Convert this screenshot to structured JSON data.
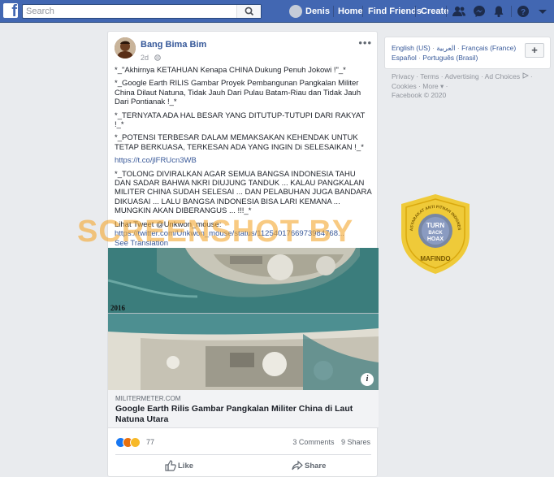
{
  "topbar": {
    "logo": "f",
    "search_placeholder": "Search",
    "user_name": "Denis",
    "nav": [
      "Home",
      "Find Friends",
      "Create"
    ]
  },
  "post": {
    "author": "Bang Bima Bim",
    "time": "2d",
    "paragraphs": [
      "*_\"Akhirnya KETAHUAN Kenapa CHINA Dukung Penuh Jokowi !\"_*",
      "*_Google Earth RILIS Gambar Proyek Pembangunan Pangkalan Militer China Dilaut Natuna, Tidak Jauh Dari Pulau Batam-Riau dan Tidak Jauh Dari Pontianak !_*",
      "*_TERNYATA ADA HAL BESAR YANG DITUTUP-TUTUPI DARI RAKYAT !_*",
      "*_POTENSI TERBESAR DALAM MEMAKSAKAN KEHENDAK UNTUK TETAP BERKUASA, TERKESAN ADA YANG INGIN Di SELESAIKAN !_*"
    ],
    "link1": "https://t.co/jlFRUcn3WB",
    "paragraph_long": "*_TOLONG DIVIRALKAN AGAR SEMUA BANGSA INDONESIA TAHU DAN SADAR BAHWA NKRI DIUJUNG TANDUK ... KALAU PANGKALAN MILITER CHINA SUDAH SELESAI ... DAN PELABUHAN JUGA BANDARA DIKUASAI ... LALU BANGSA INDONESIA BISA LARI KEMANA ... MUNGKIN AKAN DIBERANGUS ... !!!_*",
    "tweet_label": "Lihat Tweet @Unkwon_mouse:",
    "tweet_link": "https://twitter.com/Unkwon_mouse/status/11254017669739847​68...",
    "see_translation": "See Translation",
    "photo_year": "2016",
    "link_domain": "MILITERMETER.COM",
    "link_title": "Google Earth Rilis Gambar Pangkalan Militer China di Laut Natuna Utara",
    "reaction_count": "77",
    "comments": "3 Comments",
    "shares": "9 Shares",
    "like_label": "Like",
    "share_label": "Share"
  },
  "sidebar": {
    "languages": [
      "English (US)",
      "العربية",
      "Français (France)",
      "Español",
      "Português (Brasil)"
    ],
    "footer": [
      "Privacy",
      "Terms",
      "Advertising",
      "Ad Choices",
      "Cookies",
      "More"
    ],
    "copyright": "Facebook © 2020"
  },
  "overlays": {
    "watermark": "SCREENSHOT BY",
    "badge_top_text": "MASYARAKAT ANTI FITNAH INDONESIA",
    "badge_center": [
      "TURN",
      "BACK",
      "HOAX"
    ],
    "badge_bottom": "MAFINDO"
  },
  "colors": {
    "topbar": "#4267b2",
    "link": "#365899",
    "watermark": "#f5a830",
    "badge": "#f0c419"
  }
}
